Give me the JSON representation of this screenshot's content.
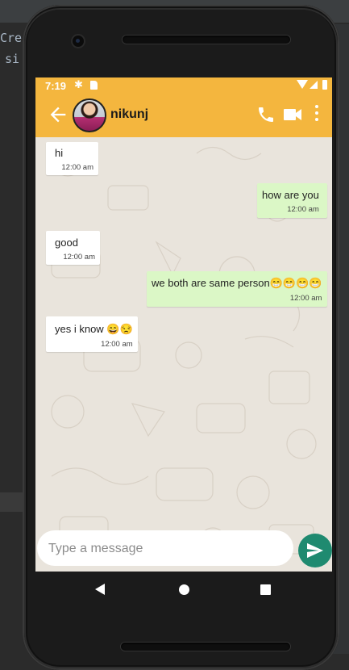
{
  "ide": {
    "fragment_1": "Cre",
    "fragment_2": "si"
  },
  "status_bar": {
    "time": "7:19",
    "icons": [
      "gear-icon",
      "sd-card-icon",
      "wifi-icon",
      "signal-icon",
      "battery-icon"
    ]
  },
  "toolbar": {
    "contact_name": "nikunj",
    "icons": [
      "back-arrow-icon",
      "phone-icon",
      "video-camera-icon",
      "more-vert-icon"
    ],
    "color": "#f4b63e"
  },
  "messages": [
    {
      "direction": "incoming",
      "text": "hi",
      "time": "12:00 am"
    },
    {
      "direction": "outgoing",
      "text": "how are you",
      "time": "12:00 am"
    },
    {
      "direction": "incoming",
      "text": "good",
      "time": "12:00 am"
    },
    {
      "direction": "outgoing",
      "text": "we both are same person😁😁😁😁",
      "time": "12:00 am"
    },
    {
      "direction": "incoming",
      "text": "yes i know 😄😒",
      "time": "12:00 am"
    }
  ],
  "composer": {
    "placeholder": "Type a message",
    "value": "",
    "send_icon": "send-icon",
    "send_color": "#1f8a70"
  },
  "colors": {
    "incoming_bubble": "#ffffff",
    "outgoing_bubble": "#dbf7c6",
    "chat_background": "#e9e4dc"
  },
  "nav_bar": {
    "icons": [
      "nav-back-icon",
      "nav-home-icon",
      "nav-recents-icon"
    ]
  }
}
